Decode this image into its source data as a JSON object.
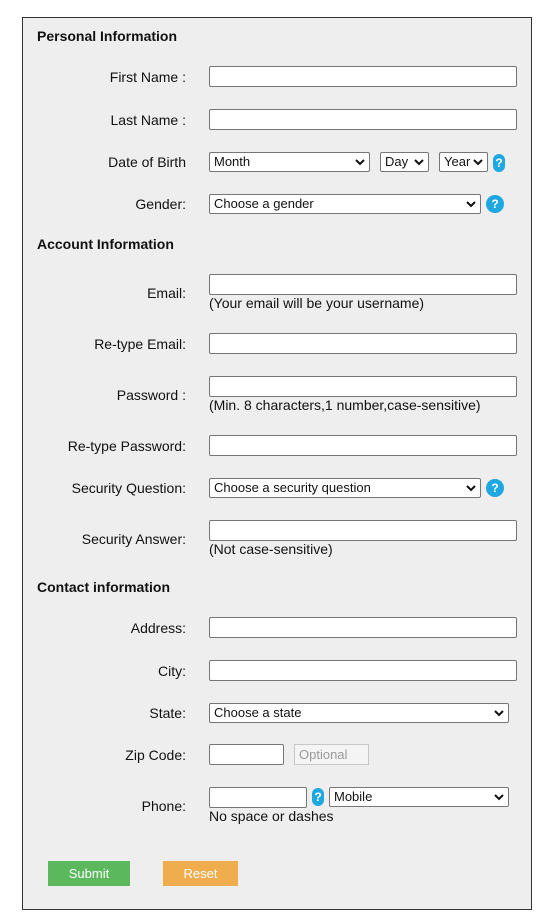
{
  "sections": {
    "personal": "Personal Information",
    "account": "Account Information",
    "contact": "Contact information"
  },
  "labels": {
    "first_name": "First Name :",
    "last_name": "Last Name :",
    "dob": "Date of Birth",
    "gender": "Gender:",
    "email": "Email:",
    "retype_email": "Re-type Email:",
    "password": "Password :",
    "retype_password": "Re-type Password:",
    "security_question": "Security Question:",
    "security_answer": "Security Answer:",
    "address": "Address:",
    "city": "City:",
    "state": "State:",
    "zip": "Zip Code:",
    "phone": "Phone:"
  },
  "selects": {
    "month": "Month",
    "day": "Day",
    "year": "Year",
    "gender": "Choose a gender",
    "security_question": "Choose a security question",
    "state": "Choose a state",
    "phone_type": "Mobile"
  },
  "hints": {
    "email": "(Your email will be your username)",
    "password": "(Min. 8 characters,1 number,case-sensitive)",
    "security_answer": "(Not case-sensitive)",
    "phone": "No space or dashes"
  },
  "placeholders": {
    "zip_extra": "Optional"
  },
  "help_glyph": "?",
  "buttons": {
    "submit": "Submit",
    "reset": "Reset"
  },
  "colors": {
    "help": "#1ea7e0",
    "submit": "#5cb85c",
    "reset": "#f0ad4e"
  }
}
